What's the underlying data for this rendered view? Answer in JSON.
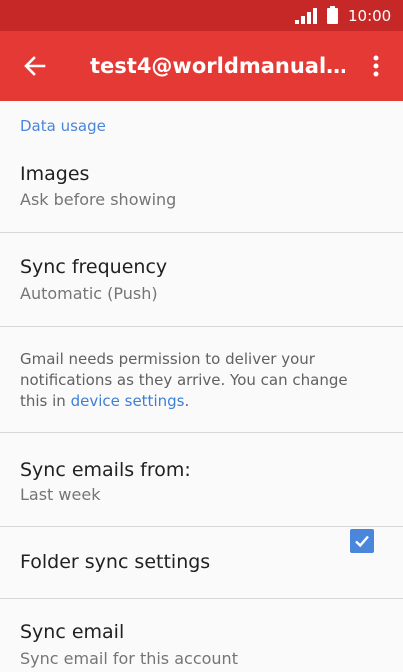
{
  "status_bar": {
    "time": "10:00"
  },
  "app_bar": {
    "title": "test4@worldmanual…"
  },
  "section": {
    "header": "Data usage"
  },
  "settings": {
    "images": {
      "title": "Images",
      "summary": "Ask before showing"
    },
    "sync_frequency": {
      "title": "Sync frequency",
      "summary": "Automatic (Push)"
    },
    "notice": {
      "text": "Gmail needs permission to deliver your notifications as they arrive. You can change this in ",
      "link": "device settings",
      "suffix": "."
    },
    "sync_emails_from": {
      "title": "Sync emails from:",
      "summary": "Last week"
    },
    "folder_sync": {
      "title": "Folder sync settings"
    },
    "sync_email": {
      "title": "Sync email",
      "summary": "Sync email for this account",
      "checked": true
    }
  },
  "colors": {
    "status_bar": "#c62828",
    "app_bar": "#e53935",
    "accent": "#4a86d9"
  }
}
